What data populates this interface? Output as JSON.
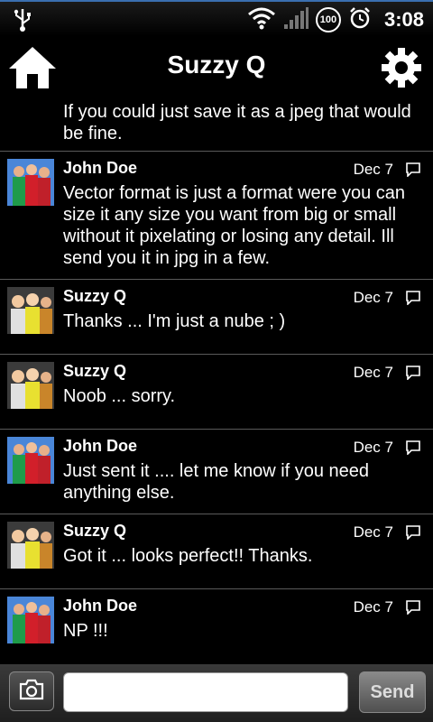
{
  "status_bar": {
    "time": "3:08",
    "battery": "100",
    "icons": [
      "usb-icon",
      "wifi-icon",
      "signal-icon",
      "battery-icon",
      "alarm-icon"
    ]
  },
  "header": {
    "title": "Suzzy Q",
    "home_icon": "home-icon",
    "settings_icon": "gear-icon"
  },
  "messages": {
    "first_text": "If you could just save it as a jpeg that would be fine.",
    "items": [
      {
        "sender": "John Doe",
        "date": "Dec 7",
        "text": "Vector format is just a format were you can size it any size you want from big or small without it pixelating or losing any detail. Ill send you it in jpg in a few."
      },
      {
        "sender": "Suzzy Q",
        "date": "Dec 7",
        "text": "Thanks ... I'm just a nube ; )"
      },
      {
        "sender": "Suzzy Q",
        "date": "Dec 7",
        "text": "Noob ... sorry."
      },
      {
        "sender": "John Doe",
        "date": "Dec 7",
        "text": "Just sent it .... let me know if you need anything else."
      },
      {
        "sender": "Suzzy Q",
        "date": "Dec 7",
        "text": "Got it ... looks perfect!!  Thanks."
      },
      {
        "sender": "John Doe",
        "date": "Dec 7",
        "text": "NP !!!"
      }
    ]
  },
  "compose": {
    "input_value": "",
    "send_label": "Send",
    "camera_icon": "camera-icon"
  },
  "colors": {
    "background": "#000000",
    "divider": "#5a5a5a",
    "status_accent": "#3a6fb0"
  }
}
